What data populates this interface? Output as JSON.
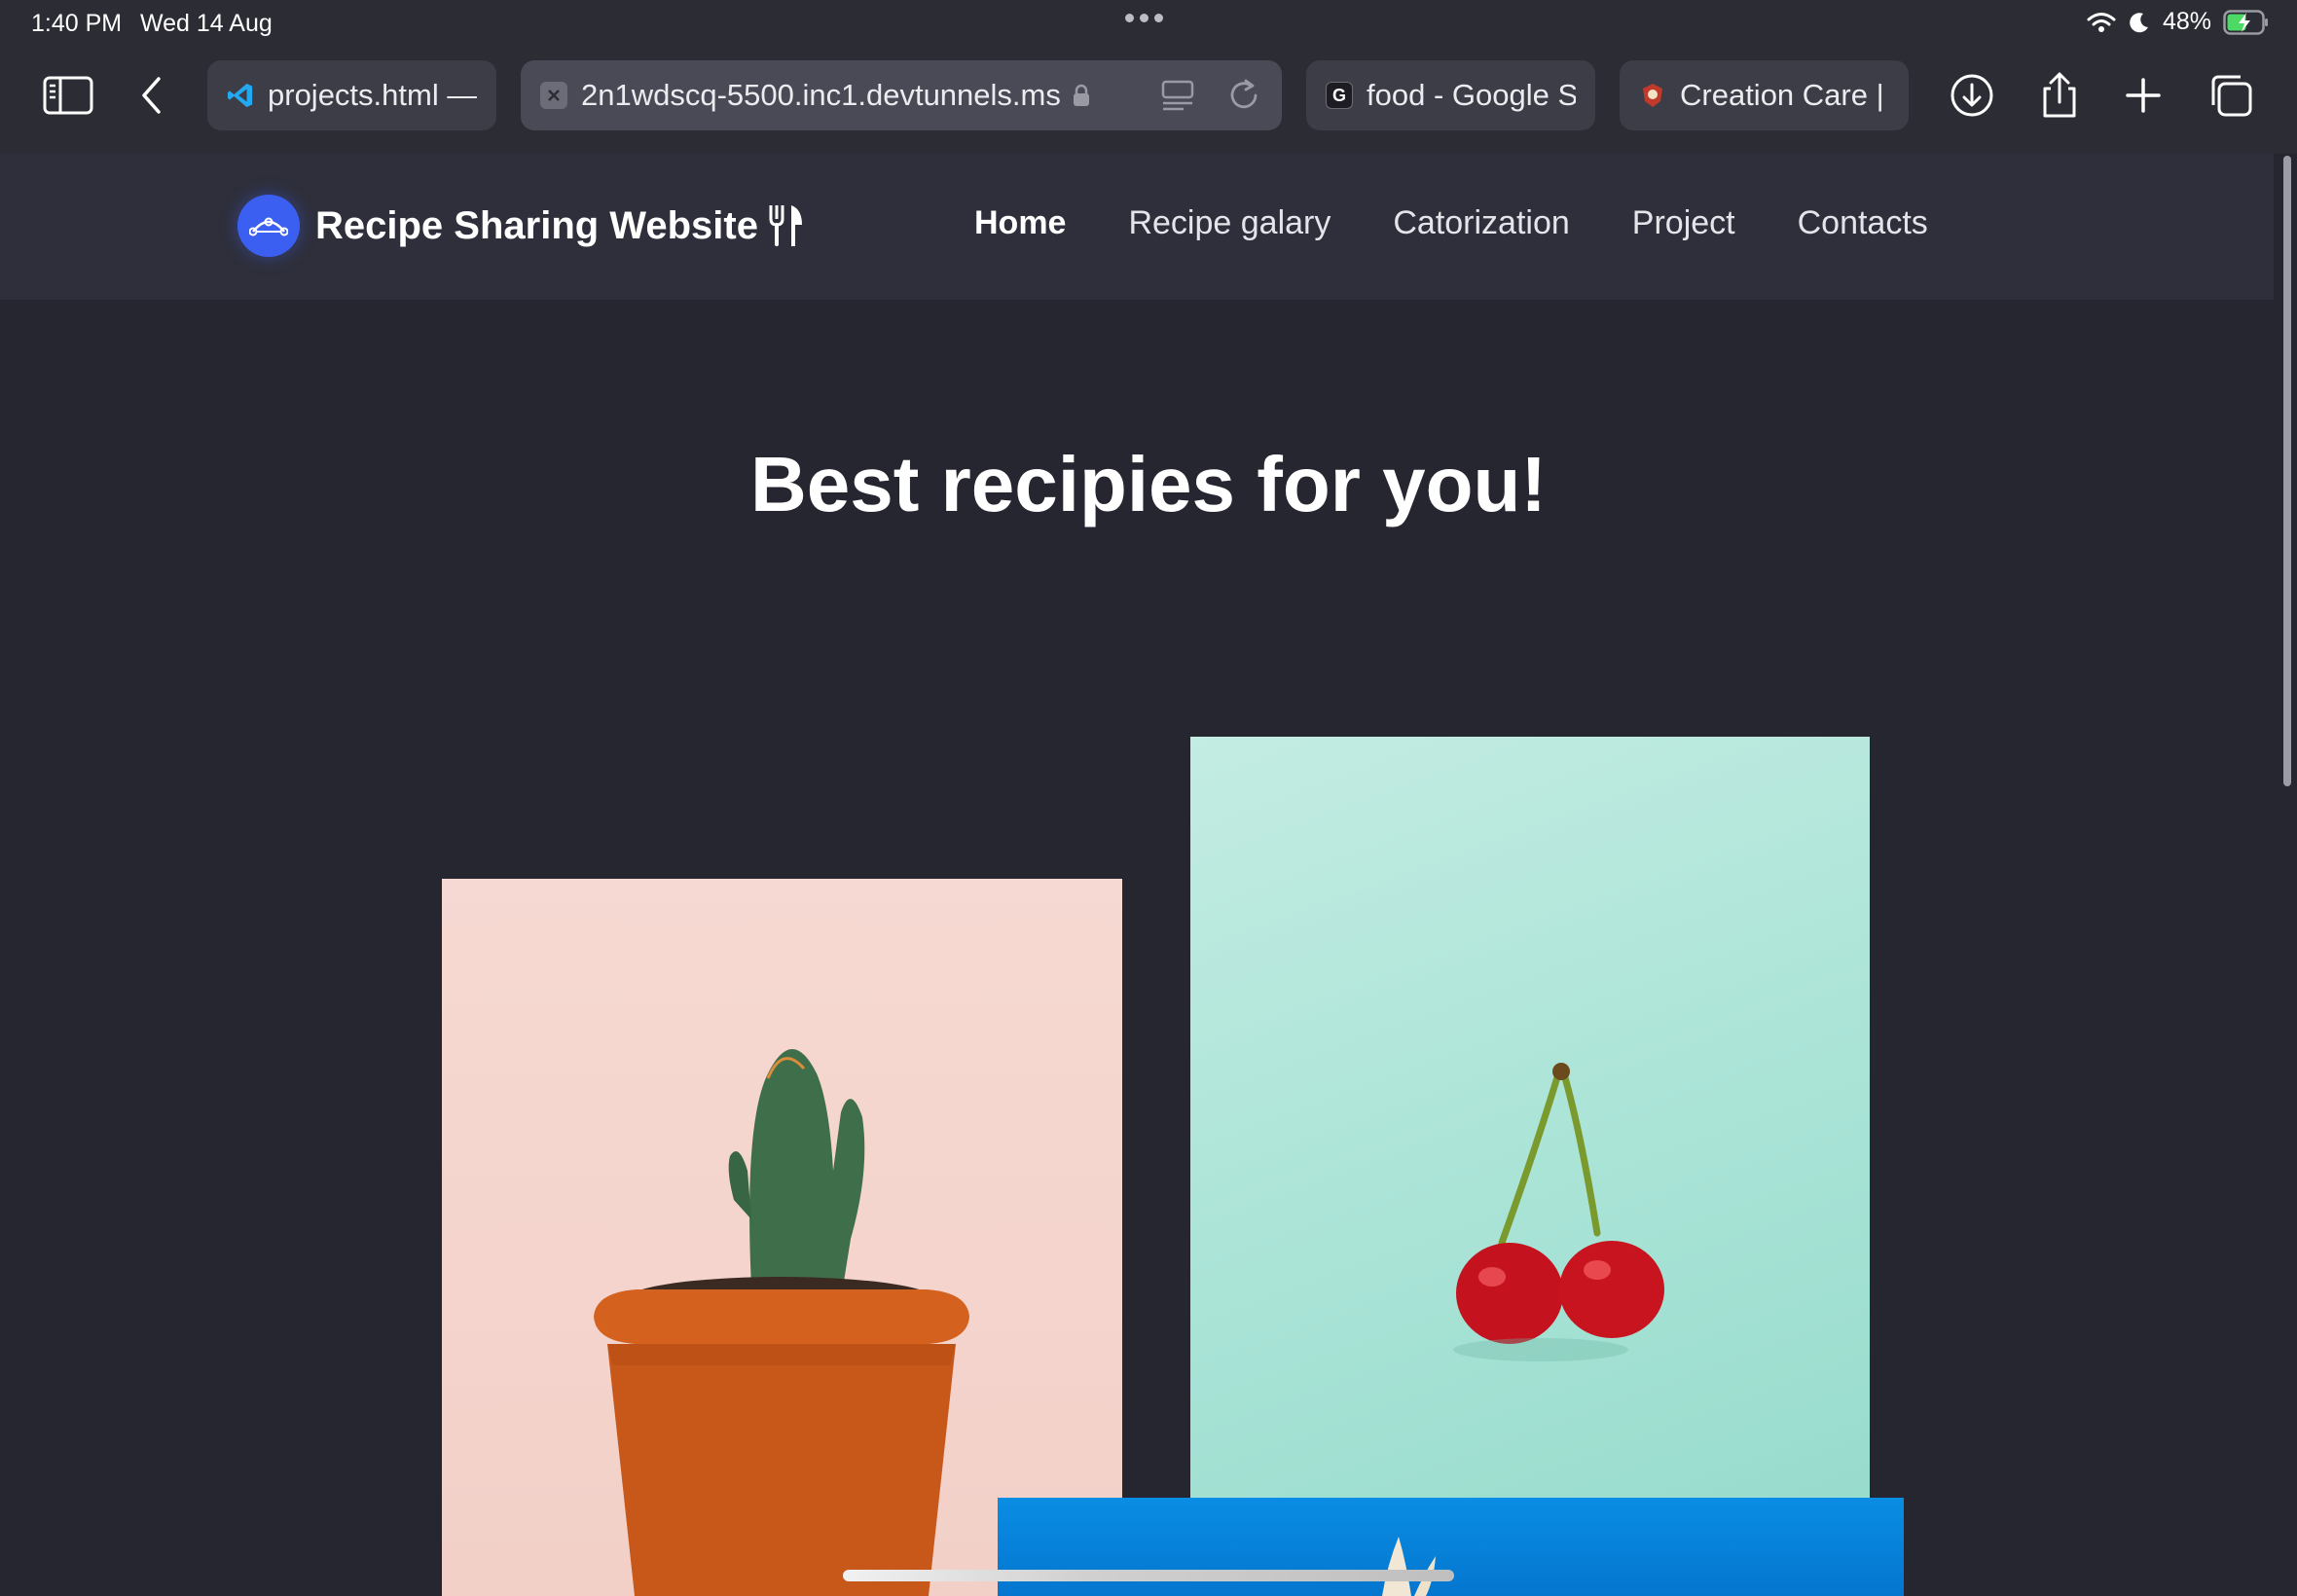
{
  "status": {
    "time": "1:40 PM",
    "date": "Wed 14 Aug",
    "battery": "48%"
  },
  "browser": {
    "tabs": [
      {
        "label": "projects.html —",
        "favicon": "vscode-icon"
      },
      {
        "label": "2n1wdscq-5500.inc1.devtunnels.ms",
        "favicon": "x-icon"
      },
      {
        "label": "food - Google S",
        "favicon": "G"
      },
      {
        "label": "Creation Care | A",
        "favicon": "crest-icon"
      }
    ]
  },
  "site": {
    "brand": "Recipe Sharing Website",
    "nav": [
      "Home",
      "Recipe galary",
      "Catorization",
      "Project",
      "Contacts"
    ],
    "hero_title": "Best recipies for you!"
  },
  "colors": {
    "page_bg": "#262630",
    "nav_bg": "#2e2f3a",
    "accent": "#3b5ff0"
  }
}
